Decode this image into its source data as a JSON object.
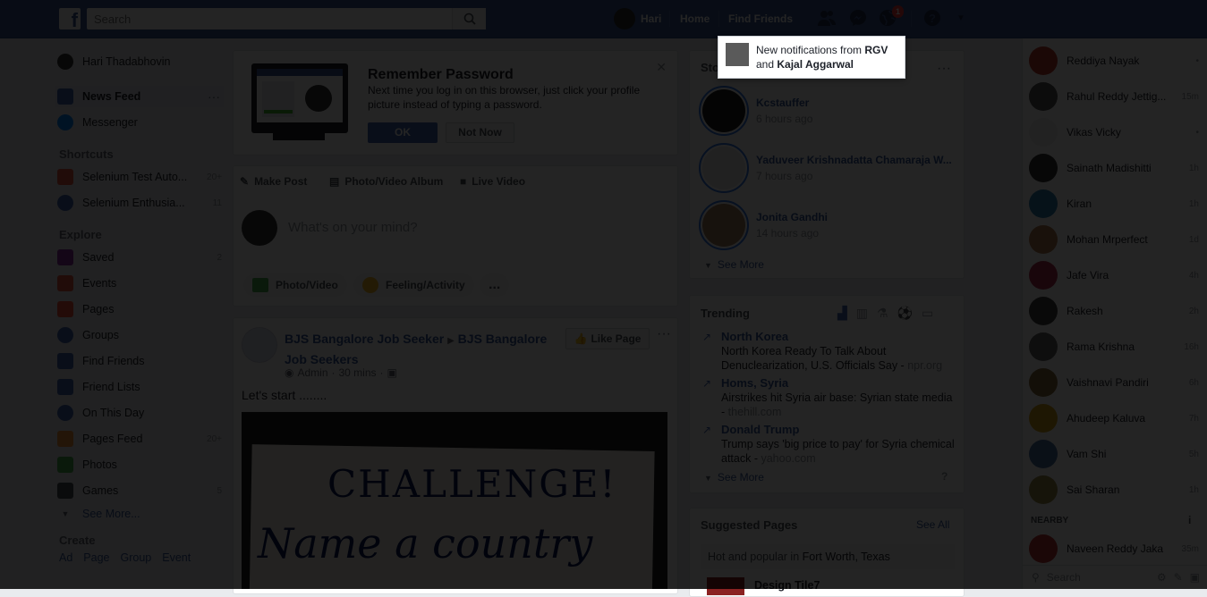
{
  "header": {
    "search_placeholder": "Search",
    "user_name": "Hari",
    "home": "Home",
    "find_friends": "Find Friends",
    "notif_count": "1"
  },
  "left": {
    "profile_name": "Hari Thadabhovin",
    "news_feed": "News Feed",
    "messenger": "Messenger",
    "shortcuts_title": "Shortcuts",
    "shortcuts": [
      {
        "label": "Selenium Test Auto...",
        "count": "20+",
        "color": "#e9573f"
      },
      {
        "label": "Selenium Enthusia...",
        "count": "11",
        "color": "#4267b2"
      }
    ],
    "explore_title": "Explore",
    "explore": [
      {
        "label": "Saved",
        "count": "2",
        "color": "#8b2fa0"
      },
      {
        "label": "Events",
        "count": "",
        "color": "#e9573f"
      },
      {
        "label": "Pages",
        "count": "",
        "color": "#f5533d"
      },
      {
        "label": "Groups",
        "count": "",
        "color": "#4267b2"
      },
      {
        "label": "Find Friends",
        "count": "",
        "color": "#4267b2"
      },
      {
        "label": "Friend Lists",
        "count": "",
        "color": "#4267b2"
      },
      {
        "label": "On This Day",
        "count": "",
        "color": "#4267b2"
      },
      {
        "label": "Pages Feed",
        "count": "20+",
        "color": "#f7923a"
      },
      {
        "label": "Photos",
        "count": "",
        "color": "#4cb050"
      },
      {
        "label": "Games",
        "count": "5",
        "color": "#4b4f56"
      }
    ],
    "see_more": "See More...",
    "create_title": "Create",
    "create_links": [
      "Ad",
      "Page",
      "Group",
      "Event"
    ]
  },
  "remember": {
    "title": "Remember Password",
    "text": "Next time you log in on this browser, just click your profile picture instead of typing a password.",
    "ok": "OK",
    "not_now": "Not Now"
  },
  "composer": {
    "make_post": "Make Post",
    "photo_album": "Photo/Video Album",
    "live_video": "Live Video",
    "placeholder": "What's on your mind?",
    "photo_video": "Photo/Video",
    "feeling": "Feeling/Activity",
    "more": "..."
  },
  "post": {
    "author": "BJS Bangalore Job Seeker",
    "arrow": "▶",
    "group": "BJS Bangalore Job Seekers",
    "role": "Admin",
    "time": "30 mins",
    "like_page": "Like Page",
    "text": "Let's start ........",
    "image_line1": "CHALLENGE!",
    "image_line2": "Name a country"
  },
  "stories": {
    "title": "Stories",
    "items": [
      {
        "name": "Kcstauffer",
        "time": "6 hours ago"
      },
      {
        "name": "Yaduveer Krishnadatta Chamaraja W...",
        "time": "7 hours ago"
      },
      {
        "name": "Jonita Gandhi",
        "time": "14 hours ago"
      }
    ],
    "see_more": "See More"
  },
  "trending": {
    "title": "Trending",
    "items": [
      {
        "topic": "North Korea",
        "desc": "North Korea Ready To Talk About Denuclearization, U.S. Officials Say",
        "source": "npr.org"
      },
      {
        "topic": "Homs, Syria",
        "desc": "Airstrikes hit Syria air base: Syrian state media",
        "source": "thehill.com"
      },
      {
        "topic": "Donald Trump",
        "desc": "Trump says 'big price to pay' for Syria chemical attack",
        "source": "yahoo.com"
      }
    ],
    "see_more": "See More",
    "question": "?"
  },
  "suggested": {
    "title": "Suggested Pages",
    "see_all": "See All",
    "hot_prefix": "Hot and popular in",
    "location": "Fort Worth, Texas",
    "first_page": "Design Tile7"
  },
  "notification": {
    "prefix": "New notifications from",
    "name1": "RGV",
    "joiner": "and",
    "name2": "Kajal Aggarwal"
  },
  "chat": {
    "contacts": [
      {
        "name": "Reddiya Nayak",
        "time": "•",
        "color": "#c0392b"
      },
      {
        "name": "Rahul Reddy Jettig...",
        "time": "15m",
        "color": "#555"
      },
      {
        "name": "Vikas Vicky",
        "time": "•",
        "color": "#eee"
      },
      {
        "name": "Sainath Madishitti",
        "time": "1h",
        "color": "#333"
      },
      {
        "name": "Kiran",
        "time": "1h",
        "color": "#2a7fb0"
      },
      {
        "name": "Mohan Mrperfect",
        "time": "1d",
        "color": "#b27a50"
      },
      {
        "name": "Jafe Vira",
        "time": "4h",
        "color": "#b03050"
      },
      {
        "name": "Rakesh",
        "time": "2h",
        "color": "#444"
      },
      {
        "name": "Rama Krishna",
        "time": "16h",
        "color": "#666"
      },
      {
        "name": "Vaishnavi Pandiri",
        "time": "6h",
        "color": "#8a6d3b"
      },
      {
        "name": "Ahudeep Kaluva",
        "time": "7h",
        "color": "#d4a017"
      },
      {
        "name": "Vam Shi",
        "time": "5h",
        "color": "#4a6fa5"
      },
      {
        "name": "Sai Sharan",
        "time": "1h",
        "color": "#9a8c4a"
      }
    ],
    "nearby_title": "NEARBY",
    "nearby": [
      {
        "name": "Naveen Reddy Jaka",
        "time": "35m",
        "color": "#b33"
      }
    ],
    "search_placeholder": "Search"
  }
}
